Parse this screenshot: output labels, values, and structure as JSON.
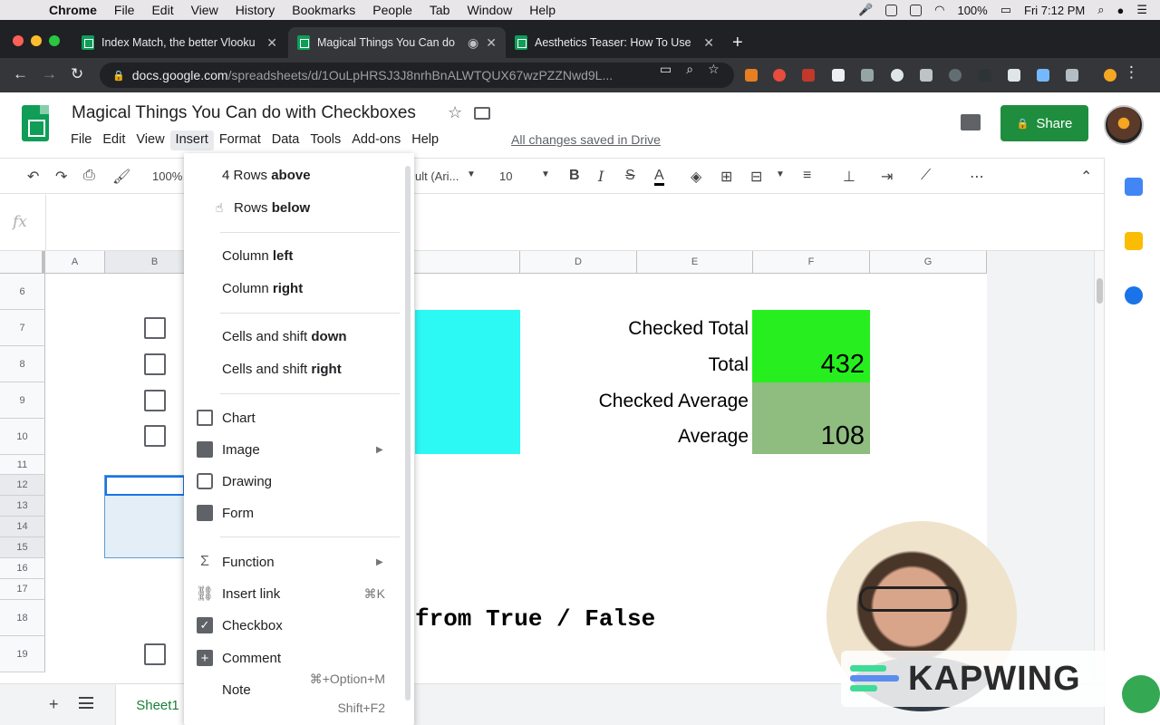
{
  "mac": {
    "app": "Chrome",
    "menus": [
      "File",
      "Edit",
      "View",
      "History",
      "Bookmarks",
      "People",
      "Tab",
      "Window",
      "Help"
    ],
    "battery": "100%",
    "clock": "Fri 7:12 PM"
  },
  "tabs": [
    {
      "title": "Index Match, the better Vlooku"
    },
    {
      "title": "Magical Things You Can do"
    },
    {
      "title": "Aesthetics Teaser: How To Use"
    }
  ],
  "url": {
    "host": "docs.google.com",
    "path": "/spreadsheets/d/1OuLpHRSJ3J8nrhBnALWTQUX67wzPZZNwd9L..."
  },
  "doc": {
    "title": "Magical Things You Can do with Checkboxes",
    "menus": [
      "File",
      "Edit",
      "View",
      "Insert",
      "Format",
      "Data",
      "Tools",
      "Add-ons",
      "Help"
    ],
    "saved": "All changes saved in Drive",
    "share": "Share"
  },
  "toolbar": {
    "zoom": "100%",
    "font": "ult (Ari...",
    "size": "10",
    "bold": "B",
    "italic": "I",
    "strike": "S",
    "textcolor": "A"
  },
  "formula": {
    "fx": "fx"
  },
  "columns": [
    "A",
    "B",
    "C",
    "D",
    "E",
    "F",
    "G"
  ],
  "rows": [
    "6",
    "7",
    "8",
    "9",
    "10",
    "11",
    "12",
    "13",
    "14",
    "15",
    "16",
    "17",
    "18",
    "19"
  ],
  "cells": {
    "checked_total_label": "Checked Total",
    "total_label": "Total",
    "total_value": "432",
    "checked_average_label": "Checked Average",
    "average_label": "Average",
    "average_value": "108",
    "big_text": "from True / False"
  },
  "colors": {
    "cyan": "#2cf8f4",
    "green": "#27ef1f",
    "sage": "#8fbc7f",
    "accent": "#1e8e3e"
  },
  "sheet": {
    "add": "+",
    "name": "Sheet1"
  },
  "insert_menu": {
    "rows_above_pre": "4 Rows ",
    "rows_above_bold": "above",
    "rows_below_pre": "Rows ",
    "rows_below_bold": "below",
    "col_left_pre": "Column ",
    "col_left_bold": "left",
    "col_right_pre": "Column ",
    "col_right_bold": "right",
    "shift_down_pre": "Cells and shift ",
    "shift_down_bold": "down",
    "shift_right_pre": "Cells and shift ",
    "shift_right_bold": "right",
    "chart": "Chart",
    "image": "Image",
    "drawing": "Drawing",
    "form": "Form",
    "function": "Function",
    "insert_link": "Insert link",
    "insert_link_sc": "⌘K",
    "checkbox": "Checkbox",
    "comment": "Comment",
    "comment_sc": "⌘+Option+M",
    "note": "Note",
    "note_sc": "Shift+F2"
  },
  "watermark": {
    "text": "KAPWING"
  }
}
